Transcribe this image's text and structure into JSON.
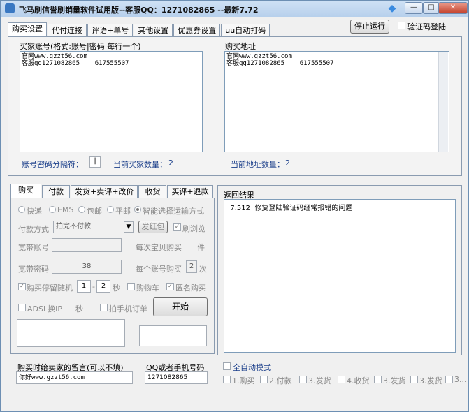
{
  "window": {
    "title": "飞马刷信誉刷销量软件试用版--客服QQ：1271082865 --最新7.72"
  },
  "top_tabs": [
    "购买设置",
    "代付连接",
    "评语+单号",
    "其他设置",
    "优惠券设置",
    "uu自动打码"
  ],
  "controls": {
    "stop_button": "停止运行",
    "captcha_login": "验证码登陆"
  },
  "buyer": {
    "title": "买家账号(格式:账号|密码 每行一个)",
    "text": "官网www.gzzt56.com\n客服qq1271082865    617555507",
    "separator_label": "账号密码分隔符：",
    "separator_value": "|",
    "count_label": "当前买家数量：",
    "count_value": "2"
  },
  "address": {
    "title": "购买地址",
    "text": "官网www.gzzt56.com\n客服qq1271082865    617555507",
    "count_label": "当前地址数量：",
    "count_value": "2"
  },
  "sub_tabs": [
    "购买",
    "付款",
    "发货+卖评+改价",
    "收货",
    "买评+退款"
  ],
  "buy": {
    "ship_opts": [
      "快递",
      "EMS",
      "包邮",
      "平邮",
      "智能选择运输方式"
    ],
    "pay_label": "付款方式",
    "pay_value": "拍完不付款",
    "red_packet": "发红包",
    "brush_review": "刷浏览",
    "bb_account_label": "宽带账号",
    "per_buy_label": "每次宝贝购买",
    "per_buy_unit": "件",
    "bb_password_label": "宽带密码",
    "bb_password_value": "38",
    "per_account_label": "每个账号购买",
    "per_account_value": "2",
    "per_account_unit": "次",
    "stay_label": "购买停留随机",
    "stay_min": "1",
    "stay_dash": "-",
    "stay_max": "2",
    "stay_unit": "秒",
    "cart": "购物车",
    "anonymous": "匿名购买",
    "adsl": "ADSL换IP",
    "adsl_unit": "秒",
    "mobile_order": "拍手机订单",
    "start": "开始"
  },
  "result": {
    "title": "返回结果",
    "text": "  7.512  修复登陆验证码经常报错的问题"
  },
  "bottom": {
    "message_label": "购买时给卖家的留言(可以不填)",
    "message_value": "你好www.gzzt56.com",
    "phone_label": "QQ或者手机号码",
    "phone_value": "1271082865",
    "auto_mode": "全自动模式",
    "steps": [
      "1.购买",
      "2.付款",
      "3.发货",
      "4.收货",
      "3.发货",
      "3.发货",
      "3..."
    ]
  }
}
